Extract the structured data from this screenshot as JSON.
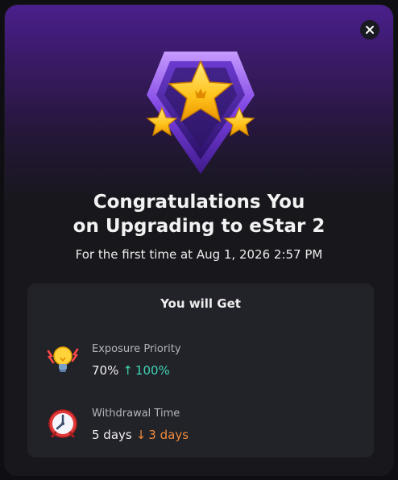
{
  "dialog": {
    "title_line1": "Congratulations You",
    "title_line2": "on Upgrading to eStar 2",
    "subtitle": "For the first time at Aug 1, 2026 2:57 PM",
    "close_icon": "close-icon",
    "badge_icon": "star-shield-badge-icon"
  },
  "benefits_card": {
    "heading": "You will Get",
    "items": [
      {
        "icon": "lightbulb-icon",
        "label": "Exposure Priority",
        "current": "70%",
        "arrow": "↑",
        "new": "100%",
        "direction": "up"
      },
      {
        "icon": "clock-icon",
        "label": "Withdrawal Time",
        "current": "5 days",
        "arrow": "↓",
        "new": "3 days",
        "direction": "down"
      }
    ]
  },
  "colors": {
    "accent_purple": "#4a1f8c",
    "increase": "#3fd6b2",
    "decrease": "#f28a3a"
  }
}
